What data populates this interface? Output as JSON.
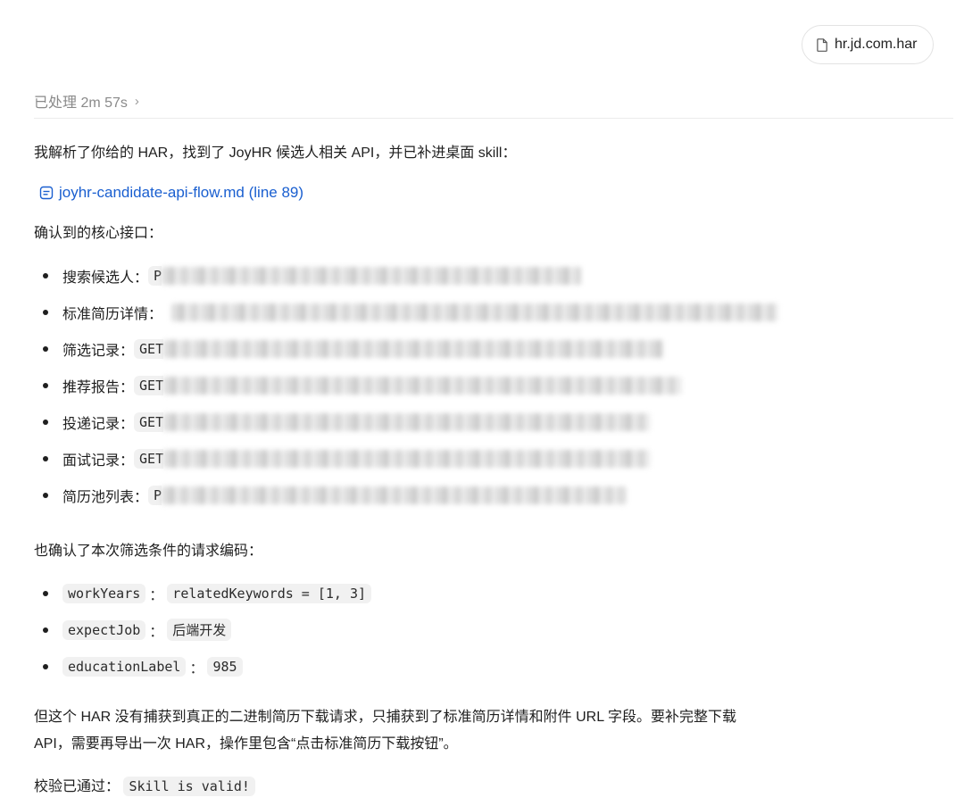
{
  "file_chip": {
    "label": "hr.jd.com.har",
    "icon": "file-icon"
  },
  "status": {
    "processed_text": "已处理 2m 57s",
    "chevron": "›"
  },
  "intro": "我解析了你给的 HAR，找到了 JoyHR 候选人相关 API，并已补进桌面 skill：",
  "doc_link": {
    "label": "joyhr-candidate-api-flow.md (line 89)",
    "icon": "document-icon"
  },
  "core_api_heading": "确认到的核心接口：",
  "core_apis": [
    {
      "label": "搜索候选人：",
      "code_start": "P"
    },
    {
      "label": "标准简历详情：",
      "code_start": ""
    },
    {
      "label": "筛选记录：",
      "code_start": "GET"
    },
    {
      "label": "推荐报告：",
      "code_start": "GET"
    },
    {
      "label": "投递记录：",
      "code_start": "GET"
    },
    {
      "label": "面试记录：",
      "code_start": "GET"
    },
    {
      "label": "简历池列表：",
      "code_start": "P"
    }
  ],
  "filter_heading": "也确认了本次筛选条件的请求编码：",
  "filters": [
    {
      "key": "workYears",
      "sep": "：",
      "value": "relatedKeywords = [1, 3]"
    },
    {
      "key": "expectJob",
      "sep": "：",
      "value": "后端开发"
    },
    {
      "key": "educationLabel",
      "sep": "：",
      "value": "985"
    }
  ],
  "note_line1": "但这个 HAR 没有捕获到真正的二进制简历下载请求，只捕获到了标准简历详情和附件 URL 字段。要补完整下载",
  "note_line2": "API，需要再导出一次 HAR，操作里包含“点击标准简历下载按钮”。",
  "validation": {
    "label": "校验已通过：",
    "result": "Skill is valid!"
  }
}
